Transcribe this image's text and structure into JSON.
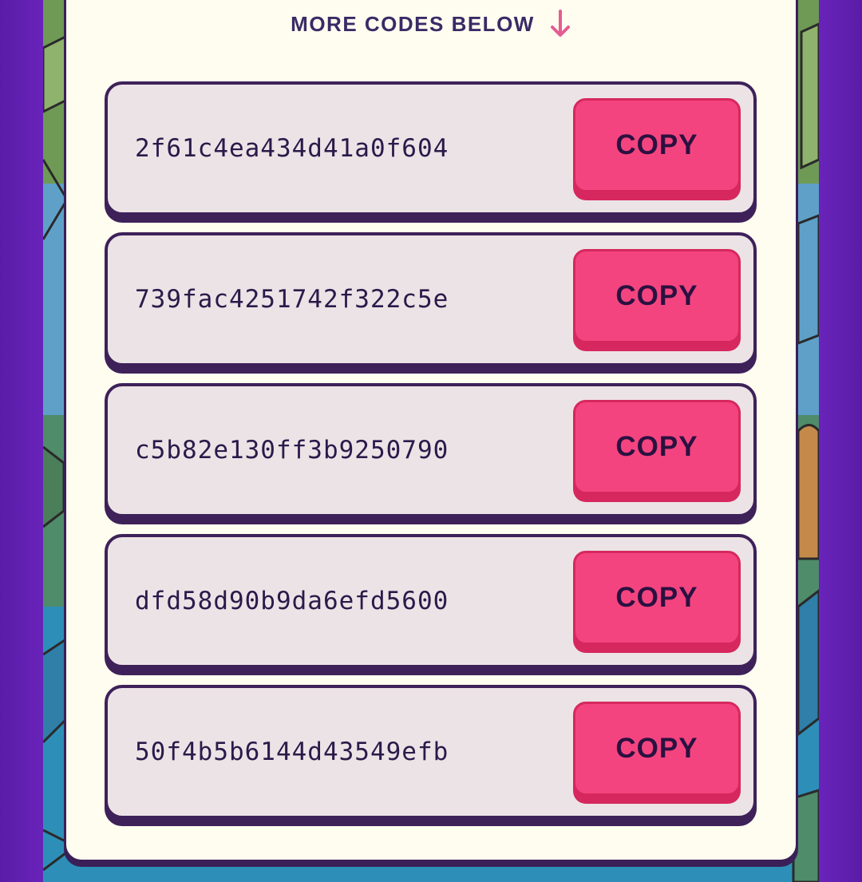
{
  "header": {
    "more_label": "MORE CODES BELOW",
    "arrow_icon": "arrow-down-icon",
    "arrow_color": "#e55c93"
  },
  "codes": [
    {
      "code": "2f61c4ea434d41a0f604",
      "button_label": "COPY"
    },
    {
      "code": "739fac4251742f322c5e",
      "button_label": "COPY"
    },
    {
      "code": "c5b82e130ff3b9250790",
      "button_label": "COPY"
    },
    {
      "code": "dfd58d90b9da6efd5600",
      "button_label": "COPY"
    },
    {
      "code": "50f4b5b6144d43549efb",
      "button_label": "COPY"
    }
  ],
  "colors": {
    "page_background": "#5e1fae",
    "panel_background": "#fffdf0",
    "row_background": "#ece3e6",
    "outline": "#3e2159",
    "button": "#f4447f",
    "button_shadow": "#d6285e",
    "text": "#2a1a4a"
  }
}
